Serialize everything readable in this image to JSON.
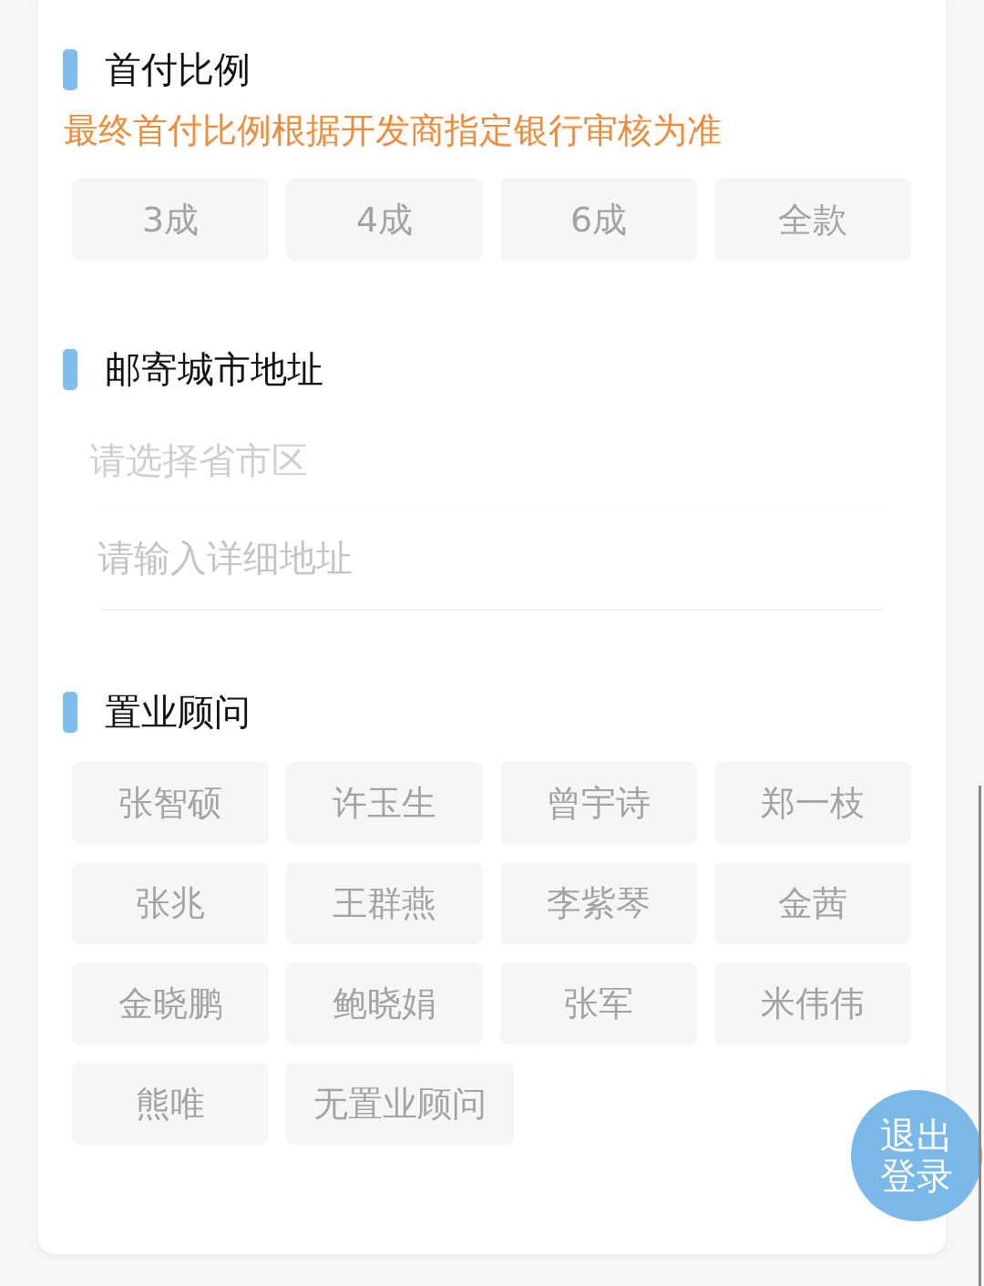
{
  "sections": [
    {
      "kind": "options",
      "title": "首付比例",
      "note": "最终首付比例根据开发商指定银行审核为准",
      "options": [
        {
          "label": "3成",
          "selected": false
        },
        {
          "label": "4成",
          "selected": false
        },
        {
          "label": "6成",
          "selected": false
        },
        {
          "label": "全款",
          "selected": false
        }
      ]
    },
    {
      "kind": "address",
      "title": "邮寄城市地址",
      "region_field": {
        "placeholder": "请选择省市区"
      },
      "detail_field": {
        "placeholder": "请输入详细地址"
      }
    },
    {
      "kind": "options",
      "title": "置业顾问",
      "options": [
        {
          "label": "张智硕",
          "selected": false
        },
        {
          "label": "许玉生",
          "selected": false
        },
        {
          "label": "曾宇诗",
          "selected": false
        },
        {
          "label": "郑一枝",
          "selected": false
        },
        {
          "label": "张兆",
          "selected": false
        },
        {
          "label": "王群燕",
          "selected": false
        },
        {
          "label": "李紫琴",
          "selected": false
        },
        {
          "label": "金茜",
          "selected": false
        },
        {
          "label": "金晓鹏",
          "selected": false
        },
        {
          "label": "鲍晓娟",
          "selected": false
        },
        {
          "label": "张军",
          "selected": false
        },
        {
          "label": "米伟伟",
          "selected": false
        },
        {
          "label": "熊唯",
          "selected": false
        },
        {
          "label": "无置业顾问",
          "selected": false
        }
      ]
    }
  ],
  "logout_button": {
    "label": "退出登录"
  }
}
